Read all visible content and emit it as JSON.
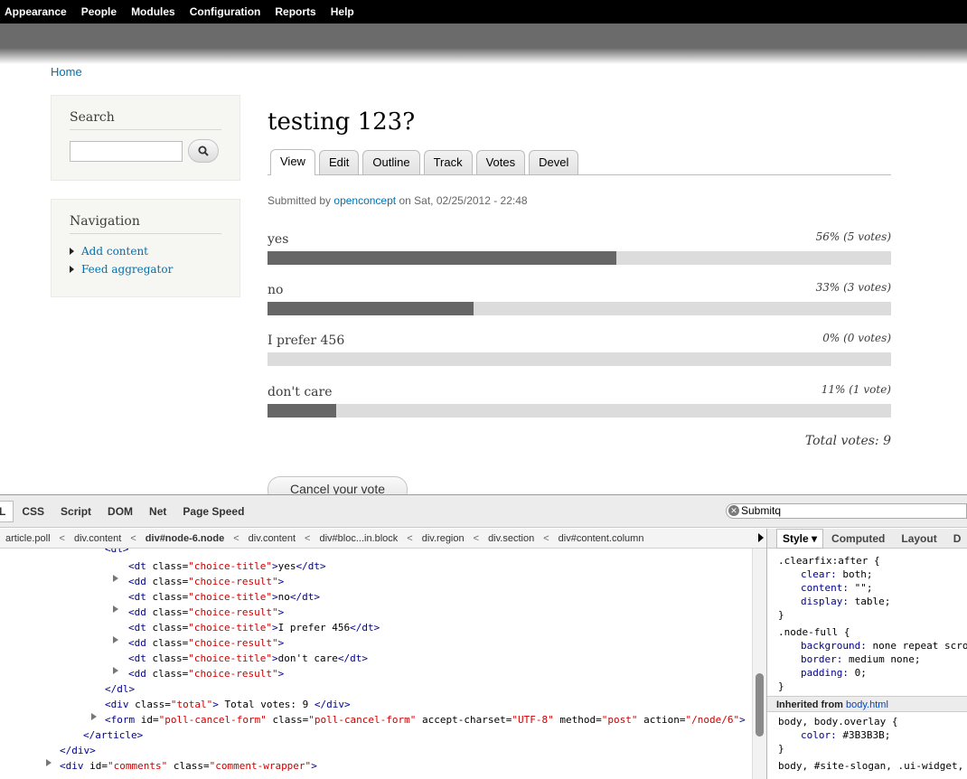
{
  "toolbar": {
    "items": [
      "Appearance",
      "People",
      "Modules",
      "Configuration",
      "Reports",
      "Help"
    ]
  },
  "breadcrumb": {
    "home": "Home"
  },
  "search_block": {
    "title": "Search",
    "button_icon": "search-icon"
  },
  "navigation": {
    "title": "Navigation",
    "items": [
      "Add content",
      "Feed aggregator"
    ]
  },
  "node": {
    "title": "testing 123?",
    "tabs": [
      "View",
      "Edit",
      "Outline",
      "Track",
      "Votes",
      "Devel"
    ],
    "active_tab": "View",
    "submitted_prefix": "Submitted by",
    "author": "openconcept",
    "submitted_suffix": "on Sat, 02/25/2012 - 22:48"
  },
  "poll": {
    "choices": [
      {
        "title": "yes",
        "result": "56% (5 votes)",
        "percent": 56
      },
      {
        "title": "no",
        "result": "33% (3 votes)",
        "percent": 33
      },
      {
        "title": "I prefer 456",
        "result": "0% (0 votes)",
        "percent": 0
      },
      {
        "title": "don't care",
        "result": "11% (1 vote)",
        "percent": 11
      }
    ],
    "total": "Total votes: 9",
    "cancel_label": "Cancel your vote"
  },
  "firebug": {
    "tabs": [
      "L",
      "CSS",
      "Script",
      "DOM",
      "Net",
      "Page Speed"
    ],
    "search_value": "Submitq",
    "breadcrumbs": [
      "article.poll",
      "div.content",
      "div#node-6.node",
      "div.content",
      "div#bloc...in.block",
      "div.region",
      "div.section",
      "div#content.column"
    ],
    "side_tabs": [
      "Style",
      "Computed",
      "Layout",
      "D"
    ],
    "inherited_label": "Inherited from",
    "inherited_source": "body.html"
  },
  "colors": {
    "toolbar": "#000000",
    "link": "#0071b3",
    "bar_fill": "#666666",
    "bar_bg": "#dcdcdc"
  }
}
